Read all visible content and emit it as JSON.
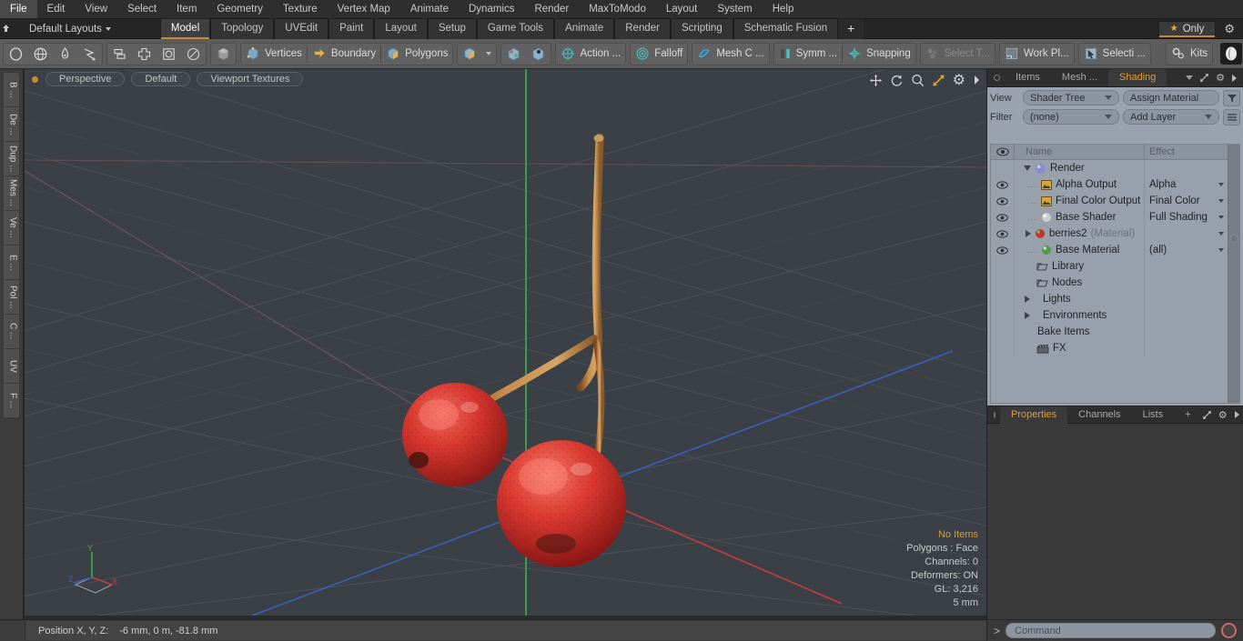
{
  "app": {
    "title": "MODO",
    "accent": "#c98a2e",
    "panel_bg": "#9aa2ad",
    "viewport_bg": "#3b4046"
  },
  "menubar": {
    "items": [
      {
        "label": "File"
      },
      {
        "label": "Edit"
      },
      {
        "label": "View"
      },
      {
        "label": "Select"
      },
      {
        "label": "Item"
      },
      {
        "label": "Geometry"
      },
      {
        "label": "Texture"
      },
      {
        "label": "Vertex Map"
      },
      {
        "label": "Animate"
      },
      {
        "label": "Dynamics"
      },
      {
        "label": "Render"
      },
      {
        "label": "MaxToModo"
      },
      {
        "label": "Layout"
      },
      {
        "label": "System"
      },
      {
        "label": "Help"
      }
    ]
  },
  "layoutbar": {
    "home_icon": "home-icon",
    "layout_name": "Default Layouts",
    "tabs": [
      {
        "label": "Model",
        "active": true
      },
      {
        "label": "Topology",
        "active": false
      },
      {
        "label": "UVEdit",
        "active": false
      },
      {
        "label": "Paint",
        "active": false
      },
      {
        "label": "Layout",
        "active": false
      },
      {
        "label": "Setup",
        "active": false
      },
      {
        "label": "Game Tools",
        "active": false
      },
      {
        "label": "Animate",
        "active": false
      },
      {
        "label": "Render",
        "active": false
      },
      {
        "label": "Scripting",
        "active": false
      },
      {
        "label": "Schematic Fusion",
        "active": false
      }
    ],
    "add_tab": "+",
    "only_label": "Only",
    "star_icon": "star-icon",
    "gear_icon": "gear-icon"
  },
  "toolbar": {
    "group1": [
      {
        "name": "circle-select-icon"
      },
      {
        "name": "globe-select-icon"
      },
      {
        "name": "pen-select-icon"
      },
      {
        "name": "lasso-select-icon"
      }
    ],
    "group2": [
      {
        "name": "stack-icon"
      },
      {
        "name": "cross-icon"
      },
      {
        "name": "square-in-square-icon"
      },
      {
        "name": "ellipse-icon"
      }
    ],
    "group3": [
      {
        "name": "cube-grey-icon"
      }
    ],
    "modes": [
      {
        "label": "Vertices",
        "icon": "vertices-icon"
      },
      {
        "label": "Boundary",
        "icon": "boundary-icon"
      },
      {
        "label": "Polygons",
        "icon": "polygons-icon"
      }
    ],
    "mode_extra": {
      "icon": "cube-yellow-icon",
      "caret": "chevron-down-icon"
    },
    "snap_icons": [
      {
        "name": "snap-cube-a-icon"
      },
      {
        "name": "snap-cube-b-icon"
      }
    ],
    "tools": [
      {
        "label": "Action  ...",
        "icon": "action-center-icon",
        "dim": false
      },
      {
        "label": "Falloff",
        "icon": "falloff-icon",
        "dim": false
      },
      {
        "label": "Mesh C ...",
        "icon": "mesh-constraint-icon",
        "dim": false
      },
      {
        "label": "Symm ...",
        "icon": "symmetry-icon",
        "dim": false
      },
      {
        "label": "Snapping",
        "icon": "snapping-icon",
        "dim": false
      },
      {
        "label": "Select T...",
        "icon": "select-through-icon",
        "dim": true
      },
      {
        "label": "Work Pl...",
        "icon": "work-plane-icon",
        "dim": false
      },
      {
        "label": "Selecti ...",
        "icon": "selection-set-icon",
        "dim": false
      }
    ],
    "kits": {
      "label": "Kits",
      "icon": "kits-gear-icon"
    },
    "right_icons": [
      {
        "name": "modo-ball-icon"
      },
      {
        "name": "unreal-icon"
      }
    ]
  },
  "left_toolbar": {
    "items": [
      {
        "label": "B ..."
      },
      {
        "label": "De ..."
      },
      {
        "label": "Dup ..."
      },
      {
        "label": "Mes ..."
      },
      {
        "label": "Ve ..."
      },
      {
        "label": "E ..."
      },
      {
        "label": "Pol ..."
      },
      {
        "label": "C ..."
      },
      {
        "label": "UV"
      },
      {
        "label": "F ..."
      }
    ]
  },
  "viewport": {
    "pills": [
      {
        "label": "Perspective"
      },
      {
        "label": "Default"
      },
      {
        "label": "Viewport Textures"
      }
    ],
    "controls": [
      {
        "name": "pan-icon"
      },
      {
        "name": "rotate-icon"
      },
      {
        "name": "zoom-icon"
      },
      {
        "name": "maximize-icon"
      },
      {
        "name": "viewport-gear-icon"
      },
      {
        "name": "viewport-arrow-icon"
      }
    ],
    "stats": {
      "selection": "No Items",
      "polygons": "Polygons : Face",
      "channels": "Channels: 0",
      "deformers": "Deformers: ON",
      "gl": "GL: 3,216",
      "scale": "5 mm"
    },
    "gizmo": {
      "x": "X",
      "y": "Y",
      "z": "Z"
    },
    "scene_description": "Two red cherries with brown stems on a grey 3D grid"
  },
  "right_panel": {
    "tabs": [
      {
        "label": "Items",
        "active": false
      },
      {
        "label": "Mesh ...",
        "active": false
      },
      {
        "label": "Shading",
        "active": true
      }
    ],
    "tab_icons": [
      {
        "name": "chevron-down-icon"
      },
      {
        "name": "expand-icon"
      },
      {
        "name": "gear-icon"
      },
      {
        "name": "arrow-right-icon"
      }
    ],
    "view_label": "View",
    "view_value": "Shader Tree",
    "assign_material": "Assign Material",
    "filter_label": "Filter",
    "filter_value": "(none)",
    "add_layer": "Add Layer",
    "filter_icon": "funnel-icon",
    "list_icon": "list-options-icon",
    "columns": {
      "eye": "eye-icon",
      "name": "Name",
      "effect": "Effect"
    },
    "tree": [
      {
        "indent": 0,
        "expander": "down",
        "eye": false,
        "icon": "render-globe-icon",
        "name": "Render",
        "effect": "",
        "has_effect": false
      },
      {
        "indent": 1,
        "expander": "none",
        "eye": true,
        "icon": "image-output-icon",
        "name": "Alpha Output",
        "effect": "Alpha",
        "has_effect": true
      },
      {
        "indent": 1,
        "expander": "none",
        "eye": true,
        "icon": "image-output-icon",
        "name": "Final Color Output",
        "effect": "Final Color",
        "has_effect": true
      },
      {
        "indent": 1,
        "expander": "none",
        "eye": true,
        "icon": "base-shader-icon",
        "name": "Base Shader",
        "effect": "Full Shading",
        "has_effect": true
      },
      {
        "indent": 1,
        "expander": "right",
        "eye": true,
        "icon": "material-red-icon",
        "name": "berries2",
        "suffix": "(Material)",
        "effect": "",
        "has_effect": true
      },
      {
        "indent": 1,
        "expander": "none",
        "eye": true,
        "icon": "material-green-icon",
        "name": "Base Material",
        "effect": "(all)",
        "has_effect": true
      },
      {
        "indent": 1,
        "expander": "none",
        "eye": false,
        "icon": "folder-icon",
        "name": "Library",
        "effect": "",
        "has_effect": false
      },
      {
        "indent": 1,
        "expander": "none",
        "eye": false,
        "icon": "folder-icon",
        "name": "Nodes",
        "effect": "",
        "has_effect": false
      },
      {
        "indent": 0,
        "expander": "right",
        "eye": false,
        "icon": "none",
        "name": "Lights",
        "effect": "",
        "has_effect": false
      },
      {
        "indent": 0,
        "expander": "right",
        "eye": false,
        "icon": "none",
        "name": "Environments",
        "effect": "",
        "has_effect": false
      },
      {
        "indent": 0,
        "expander": "none",
        "eye": false,
        "icon": "none",
        "name": "Bake Items",
        "effect": "",
        "has_effect": false
      },
      {
        "indent": 0,
        "expander": "none",
        "eye": false,
        "icon": "fx-clapper-icon",
        "name": "FX",
        "effect": "",
        "has_effect": false
      }
    ],
    "property_tabs": [
      {
        "label": "Properties",
        "active": true
      },
      {
        "label": "Channels",
        "active": false
      },
      {
        "label": "Lists",
        "active": false
      },
      {
        "label": "+",
        "active": false
      }
    ]
  },
  "statusbar": {
    "position_label": "Position X, Y, Z:",
    "position_value": "-6 mm, 0 m, -81.8 mm",
    "prompt": ">",
    "command_placeholder": "Command",
    "record_icon": "record-icon"
  }
}
